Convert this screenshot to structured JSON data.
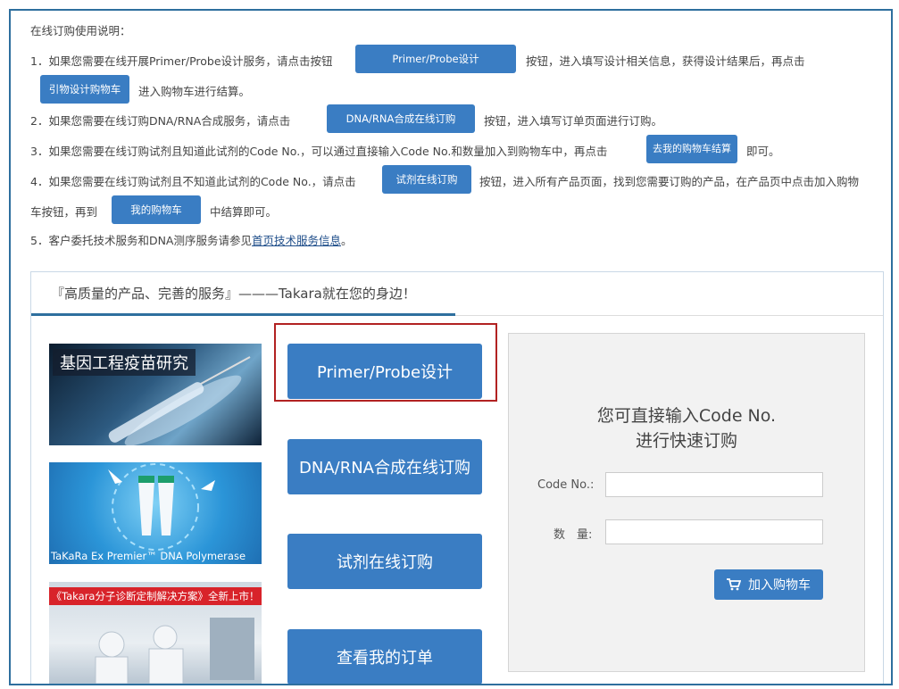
{
  "instructions": {
    "heading": "在线订购使用说明：",
    "item1_a": "1．如果您需要在线开展Primer/Probe设计服务，请点击按钮",
    "item1_btn": "Primer/Probe设计",
    "item1_b": "按钮，进入填写设计相关信息，获得设计结果后，再点击",
    "item1_btn2": "引物设计购物车",
    "item1_c": "进入购物车进行结算。",
    "item2_a": "2．如果您需要在线订购DNA/RNA合成服务，请点击",
    "item2_btn": "DNA/RNA合成在线订购",
    "item2_b": "按钮，进入填写订单页面进行订购。",
    "item3_a": "3．如果您需要在线订购试剂且知道此试剂的Code No.，可以通过直接输入Code No.和数量加入到购物车中，再点击",
    "item3_btn": "去我的购物车结算",
    "item3_b": "即可。",
    "item4_a": "4．如果您需要在线订购试剂且不知道此试剂的Code No.，请点击",
    "item4_btn": "试剂在线订购",
    "item4_b": "按钮，进入所有产品页面，找到您需要订购的产品，在产品页中点击加入购物",
    "item4_c": "车按钮，再到",
    "item4_btn2": "我的购物车",
    "item4_d": "中结算即可。",
    "item5_a": "5．客户委托技术服务和DNA测序服务请参见",
    "item5_link": "首页技术服务信息",
    "item5_b": "。"
  },
  "panel": {
    "title": "『高质量的产品、完善的服务』———Takara就在您的身边！",
    "banners": [
      {
        "caption": "基因工程疫苗研究"
      },
      {
        "caption": "TaKaRa Ex Premier™ DNA Polymerase"
      },
      {
        "caption": "《Takara分子诊断定制解决方案》全新上市！"
      }
    ],
    "buttons": [
      "Primer/Probe设计",
      "DNA/RNA合成在线订购",
      "试剂在线订购",
      "查看我的订单"
    ],
    "quick": {
      "title_line1": "您可直接输入Code No.",
      "title_line2": "进行快速订购",
      "code_label": "Code No.:",
      "qty_label": "数　量:",
      "cart_button": "加入购物车"
    }
  },
  "colors": {
    "accent": "#3a7dc3",
    "border": "#2e6f9e",
    "highlight": "#b22222"
  }
}
